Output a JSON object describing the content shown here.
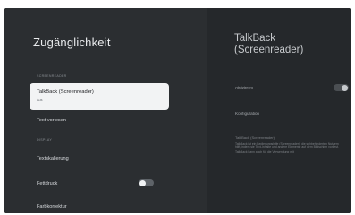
{
  "screen": {
    "title": "Zugänglichkeit",
    "sections": {
      "screenreader": "Screenreader",
      "display": "Display"
    },
    "items": {
      "talkback": {
        "label": "TalkBack (Screenreader)",
        "value": "Aus"
      },
      "text_vorlesen": "Text vorlesen",
      "textskalierung": "Textskalierung",
      "fettdruck": {
        "label": "Fettdruck",
        "toggle_on": false
      },
      "farbkorrektur": "Farbkorrektur"
    }
  },
  "detail": {
    "title": "TalkBack (Screenreader)",
    "aktivieren": {
      "label": "Aktivieren",
      "toggle_on": false
    },
    "konfiguration": "Konfiguration",
    "section_label": "TalkBack (Screenreader)",
    "description": "TalkBack ist ein Bedienungshilfe (Screenreader), die sehbehinderten Nutzern hilft, indem sie Text-Inhalte und andere Elemente auf dem Bildschirm vorliest. TalkBack kann auch für die Verwendung mit"
  }
}
